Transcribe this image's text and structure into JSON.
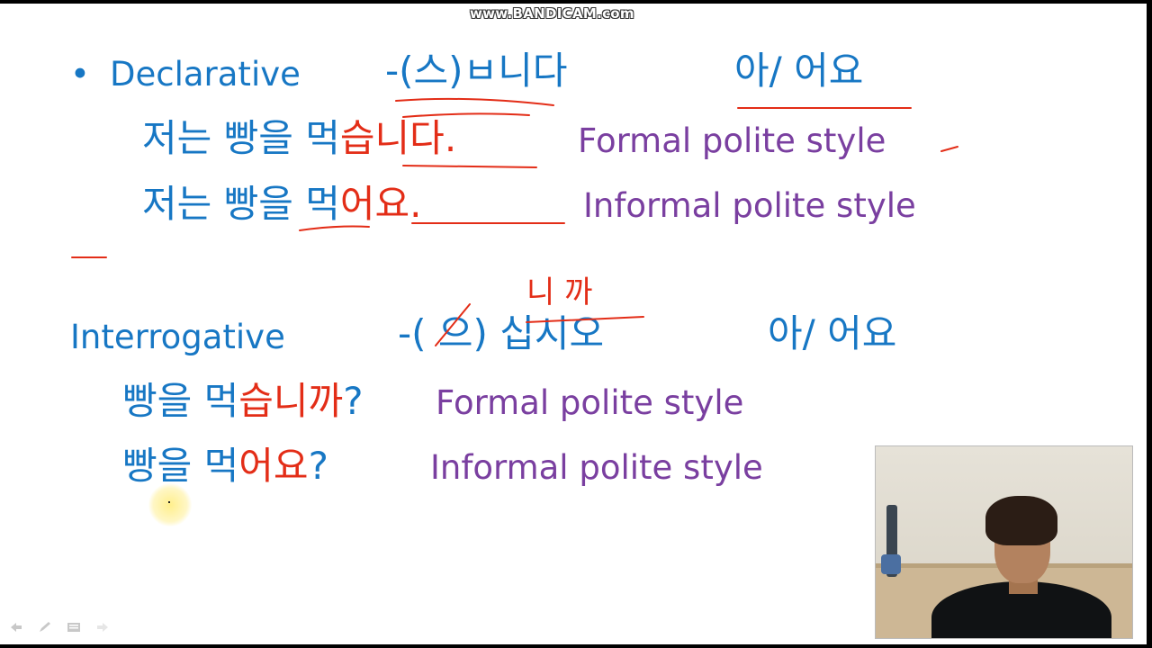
{
  "watermark": "www.BANDICAM.com",
  "slide": {
    "bullet": "•",
    "declarative": {
      "label": "Declarative",
      "ending_formal": "-(스)ㅂ니다",
      "ending_informal": "아/ 어요",
      "example_formal": {
        "stem": "저는 빵을 먹",
        "ending": "습니다.",
        "style": "Formal polite style"
      },
      "example_informal": {
        "stem": "저는 빵을  먹",
        "ending": "어요.",
        "style": "Informal polite style"
      }
    },
    "interrogative": {
      "label": "Interrogative",
      "ending_formal": "-( 으) 십시오",
      "ending_informal": "아/ 어요",
      "handwritten_correction": "니 까",
      "example_formal": {
        "stem": "빵을 먹",
        "ending": "습니까",
        "punct": "?",
        "style": "Formal polite style"
      },
      "example_informal": {
        "stem": "빵을  먹",
        "ending": "어요",
        "punct": "?",
        "style": "Informal polite style"
      }
    }
  },
  "colors": {
    "blue": "#1777c4",
    "red": "#e32d17",
    "purple": "#7a3fa0",
    "ink_red": "#e32d17"
  },
  "icons": [
    "arrow-left-icon",
    "pen-icon",
    "menu-icon",
    "arrow-right-icon"
  ]
}
